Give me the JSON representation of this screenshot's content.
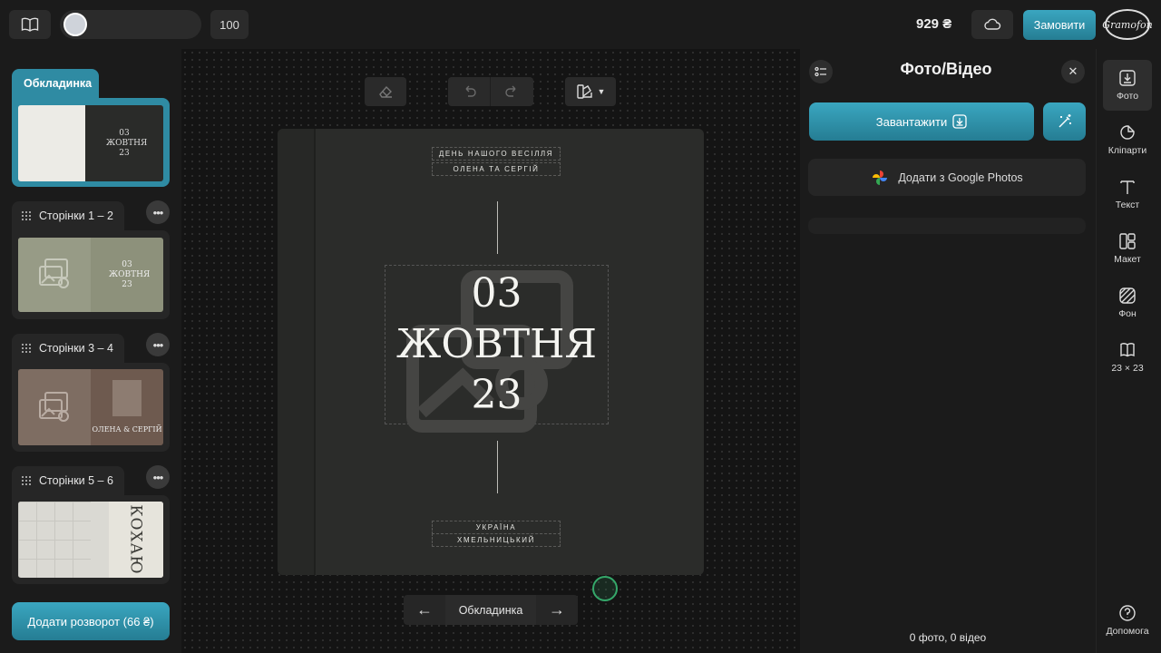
{
  "topbar": {
    "zoom_value": "100",
    "price": "929 ₴",
    "order_label": "Замовити",
    "logo_text": "Gramofon"
  },
  "sidebar": {
    "cover_label": "Обкладинка",
    "sections": [
      {
        "label": "Сторінки 1 – 2"
      },
      {
        "label": "Сторінки 3 – 4"
      },
      {
        "label": "Сторінки 5 – 6"
      }
    ],
    "more_label": "•••",
    "add_spread_label": "Додати розворот (66 ₴)",
    "thumb_texts": {
      "cover_date": "03 ЖОВТНЯ 23",
      "spread1_date": "03 ЖОВТНЯ 23",
      "spread2_names": "ОЛЕНА & СЕРГІЙ",
      "spread3_word": "КОХАЮ"
    }
  },
  "canvas": {
    "cover_top_line1": "ДЕНЬ НАШОГО ВЕСІЛЛЯ",
    "cover_top_line2": "ОЛЕНА ТА СЕРГІЙ",
    "date_line1": "03",
    "date_line2": "ЖОВТНЯ",
    "date_line3": "23",
    "cover_bottom_line1": "УКРАЇНА",
    "cover_bottom_line2": "ХМЕЛЬНИЦЬКИЙ",
    "nav_label": "Обкладинка"
  },
  "rightpanel": {
    "title": "Фото/Відео",
    "upload_label": "Завантажити",
    "gphotos_label": "Додати з Google Photos",
    "media_count": "0 фото, 0 відео"
  },
  "tools": [
    {
      "label": "Фото"
    },
    {
      "label": "Кліпарти"
    },
    {
      "label": "Текст"
    },
    {
      "label": "Макет"
    },
    {
      "label": "Фон"
    },
    {
      "label": "23 × 23"
    },
    {
      "label": "Допомога"
    }
  ],
  "colors": {
    "accent": "#2f97b0",
    "background": "#1b1b1b",
    "cover": "#2b2c2a"
  }
}
